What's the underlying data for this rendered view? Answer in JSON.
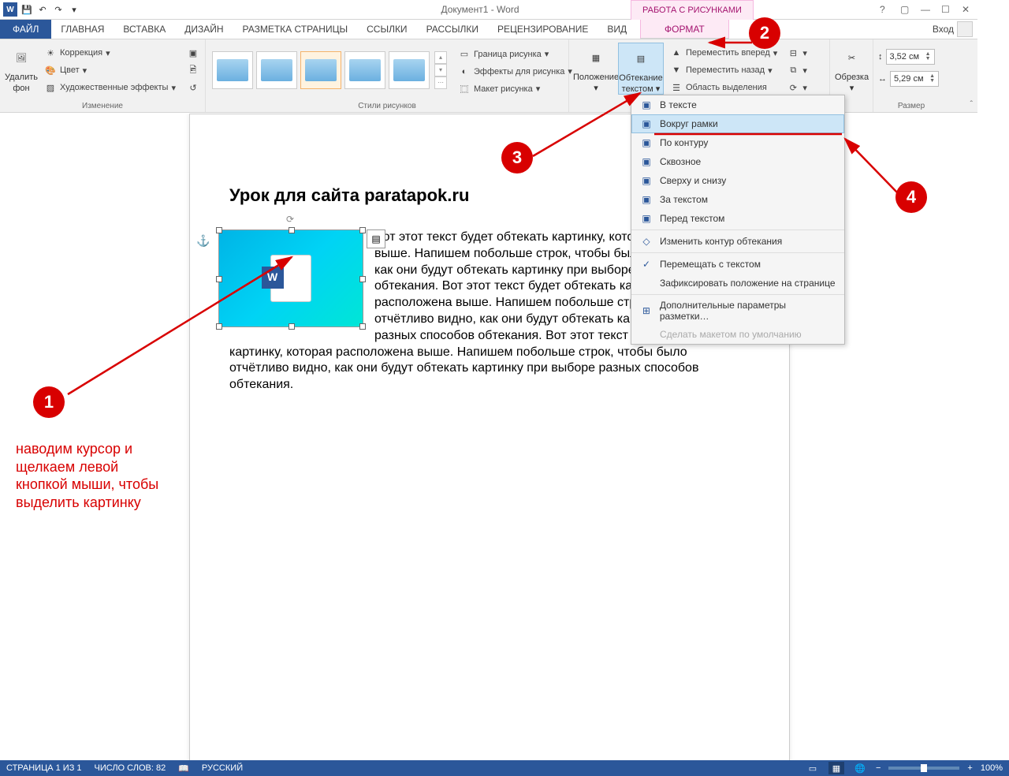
{
  "title": "Документ1 - Word",
  "contextual_tab": "РАБОТА С РИСУНКАМИ",
  "signin": "Вход",
  "tabs": {
    "file": "ФАЙЛ",
    "home": "ГЛАВНАЯ",
    "insert": "ВСТАВКА",
    "design": "ДИЗАЙН",
    "layout": "РАЗМЕТКА СТРАНИЦЫ",
    "refs": "ССЫЛКИ",
    "mail": "РАССЫЛКИ",
    "review": "РЕЦЕНЗИРОВАНИЕ",
    "view": "ВИД",
    "format": "ФОРМАТ"
  },
  "ribbon": {
    "group_adjust": {
      "remove_bg_1": "Удалить",
      "remove_bg_2": "фон",
      "corrections": "Коррекция",
      "color": "Цвет",
      "artistic": "Художественные эффекты",
      "label": "Изменение"
    },
    "group_styles": {
      "border": "Граница рисунка",
      "effects": "Эффекты для рисунка",
      "layout": "Макет рисунка",
      "label": "Стили рисунков"
    },
    "group_arrange": {
      "position": "Положение",
      "wrap_1": "Обтекание",
      "wrap_2": "текстом",
      "bring_fwd": "Переместить вперед",
      "send_back": "Переместить назад",
      "selection": "Область выделения"
    },
    "group_crop": {
      "crop": "Обрезка"
    },
    "group_size": {
      "h": "3,52 см",
      "w": "5,29 см",
      "label": "Размер"
    }
  },
  "dropdown": {
    "inline": "В тексте",
    "square": "Вокруг рамки",
    "tight": "По контуру",
    "through": "Сквозное",
    "topbottom": "Сверху и снизу",
    "behind": "За текстом",
    "front": "Перед текстом",
    "edit_points": "Изменить контур обтекания",
    "move_with": "Перемещать с текстом",
    "fix_pos": "Зафиксировать положение на странице",
    "more": "Дополнительные параметры разметки…",
    "default": "Сделать макетом по умолчанию"
  },
  "document": {
    "heading": "Урок для сайта paratapok.ru",
    "body": "Вот этот текст будет обтекать картинку, которая расположена выше. Напишем побольше строк, чтобы было отчётливо видно, как они будут обтекать картинку при выборе разных способов обтекания. Вот этот текст будет обтекать картинку, которая расположена выше. Напишем побольше строк, чтобы было отчётливо видно, как они будут обтекать картинку при выборе разных способов обтекания. Вот этот текст будет обтекать картинку, которая расположена выше. Напишем побольше строк, чтобы было отчётливо видно, как они будут обтекать картинку при выборе разных способов обтекания."
  },
  "status": {
    "page": "СТРАНИЦА 1 ИЗ 1",
    "words": "ЧИСЛО СЛОВ: 82",
    "lang": "РУССКИЙ",
    "zoom": "100%"
  },
  "annotations": {
    "n1": "1",
    "n2": "2",
    "n3": "3",
    "n4": "4",
    "hint1": "наводим курсор и щелкаем левой кнопкой мыши, чтобы выделить картинку"
  }
}
